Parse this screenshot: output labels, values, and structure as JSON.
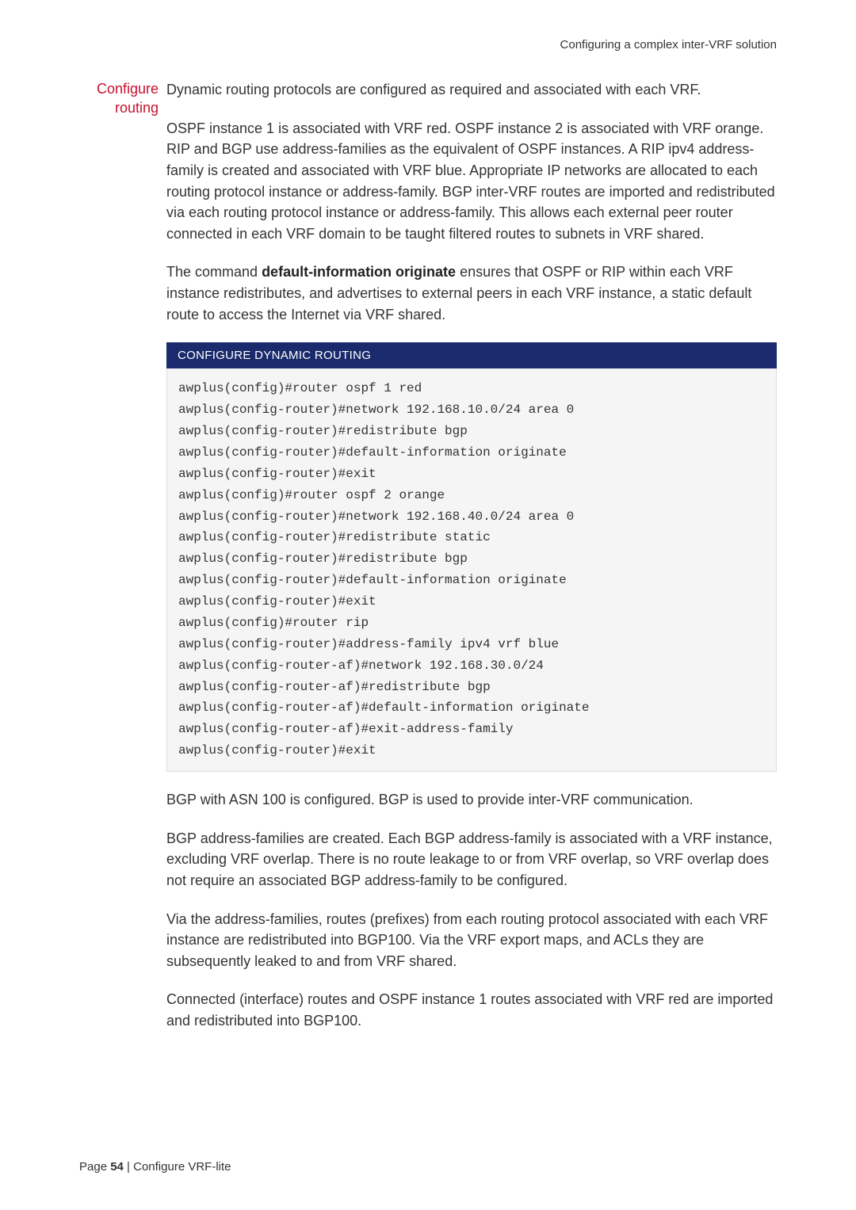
{
  "header": "Configuring a complex inter-VRF solution",
  "sideLabel1": "Configure",
  "sideLabel2": "routing",
  "intro": "Dynamic routing protocols are configured as required and associated with each VRF.",
  "para1": "OSPF instance 1 is associated with VRF red. OSPF instance 2 is associated with VRF orange. RIP and BGP use address-families as the equivalent of OSPF instances. A RIP ipv4 address-family is created and associated with VRF blue. Appropriate IP networks are allocated to each routing protocol instance or address-family. BGP inter-VRF routes are imported and redistributed via each routing protocol instance or address-family. This allows each external peer router connected in each VRF domain to be taught filtered routes to subnets in VRF shared.",
  "para2a": "The command ",
  "para2bold": "default-information originate",
  "para2b": "  ensures that OSPF or RIP within each VRF instance redistributes, and advertises to external peers in each VRF instance, a static default route to access the Internet via VRF shared.",
  "codeHeader": "CONFIGURE DYNAMIC ROUTING",
  "codeLines": [
    "awplus(config)#router ospf 1 red",
    "awplus(config-router)#network 192.168.10.0/24 area 0",
    "awplus(config-router)#redistribute bgp",
    "awplus(config-router)#default-information originate",
    "awplus(config-router)#exit",
    "awplus(config)#router ospf 2 orange",
    "awplus(config-router)#network 192.168.40.0/24 area 0",
    "awplus(config-router)#redistribute static",
    "awplus(config-router)#redistribute bgp",
    "awplus(config-router)#default-information originate",
    "awplus(config-router)#exit",
    "awplus(config)#router rip",
    "awplus(config-router)#address-family ipv4 vrf blue",
    "awplus(config-router-af)#network 192.168.30.0/24",
    "awplus(config-router-af)#redistribute bgp",
    "awplus(config-router-af)#default-information originate",
    "awplus(config-router-af)#exit-address-family",
    "awplus(config-router)#exit"
  ],
  "para3": "BGP with ASN 100 is configured. BGP is used to provide inter-VRF communication.",
  "para4": "BGP address-families are created. Each BGP address-family is associated with a VRF instance, excluding VRF overlap. There is no route leakage to or from VRF overlap, so VRF overlap does not require an associated BGP address-family to be configured.",
  "para5": "Via the address-families, routes (prefixes) from each routing protocol associated with each VRF instance are redistributed into BGP100. Via the VRF export maps, and ACLs they are subsequently leaked to and from VRF shared.",
  "para6": "Connected (interface) routes and OSPF instance 1 routes associated with VRF red are imported and redistributed into BGP100.",
  "footerPre": "Page ",
  "footerNum": "54",
  "footerSep": " |  ",
  "footerTitle": "Configure VRF-lite"
}
